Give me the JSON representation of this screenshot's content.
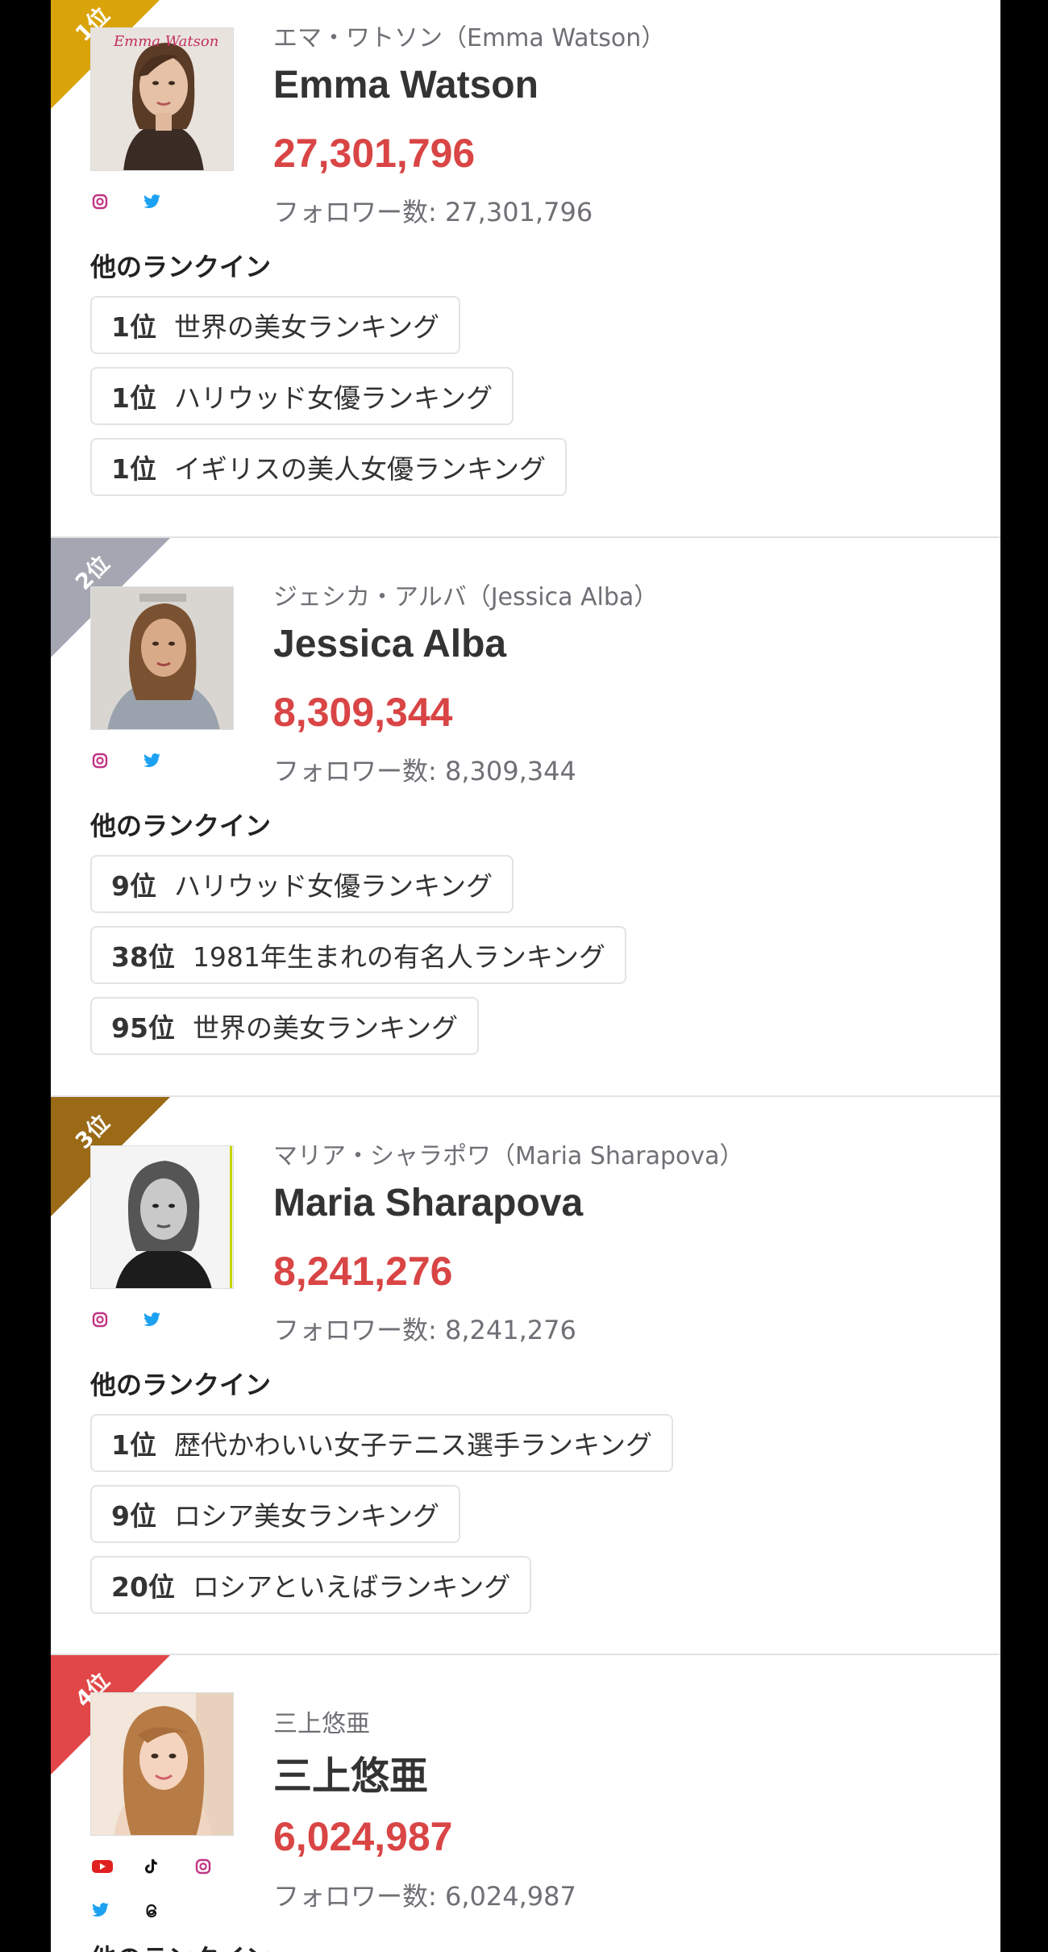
{
  "colors": {
    "rank1": "#d9a40a",
    "rank2": "#a4a6b1",
    "rank3": "#9a6a17",
    "rank4": "#e14747",
    "followers": "#d94545"
  },
  "entries": [
    {
      "rank": "1位",
      "kana": "エマ・ワトソン（Emma Watson）",
      "name": "Emma Watson",
      "followers": "27,301,796",
      "followers_label": "フォロワー数: 27,301,796",
      "photo_caption": "Emma Watson",
      "sns": [
        "instagram-icon",
        "twitter-icon"
      ],
      "other_title": "他のランクイン",
      "rankings": [
        {
          "rank": "1位",
          "label": "世界の美女ランキング"
        },
        {
          "rank": "1位",
          "label": "ハリウッド女優ランキング"
        },
        {
          "rank": "1位",
          "label": "イギリスの美人女優ランキング"
        }
      ]
    },
    {
      "rank": "2位",
      "kana": "ジェシカ・アルバ（Jessica Alba）",
      "name": "Jessica Alba",
      "followers": "8,309,344",
      "followers_label": "フォロワー数: 8,309,344",
      "sns": [
        "instagram-icon",
        "twitter-icon"
      ],
      "other_title": "他のランクイン",
      "rankings": [
        {
          "rank": "9位",
          "label": "ハリウッド女優ランキング"
        },
        {
          "rank": "38位",
          "label": "1981年生まれの有名人ランキング"
        },
        {
          "rank": "95位",
          "label": "世界の美女ランキング"
        }
      ]
    },
    {
      "rank": "3位",
      "kana": "マリア・シャラポワ（Maria Sharapova）",
      "name": "Maria Sharapova",
      "followers": "8,241,276",
      "followers_label": "フォロワー数: 8,241,276",
      "sns": [
        "instagram-icon",
        "twitter-icon"
      ],
      "other_title": "他のランクイン",
      "rankings": [
        {
          "rank": "1位",
          "label": "歴代かわいい女子テニス選手ランキング"
        },
        {
          "rank": "9位",
          "label": "ロシア美女ランキング"
        },
        {
          "rank": "20位",
          "label": "ロシアといえばランキング"
        }
      ]
    },
    {
      "rank": "4位",
      "kana": "三上悠亜",
      "name": "三上悠亜",
      "followers": "6,024,987",
      "followers_label": "フォロワー数: 6,024,987",
      "sns": [
        "youtube-icon",
        "tiktok-icon",
        "instagram-icon",
        "twitter-icon",
        "threads-icon"
      ],
      "other_title": "他のランクイン"
    }
  ]
}
